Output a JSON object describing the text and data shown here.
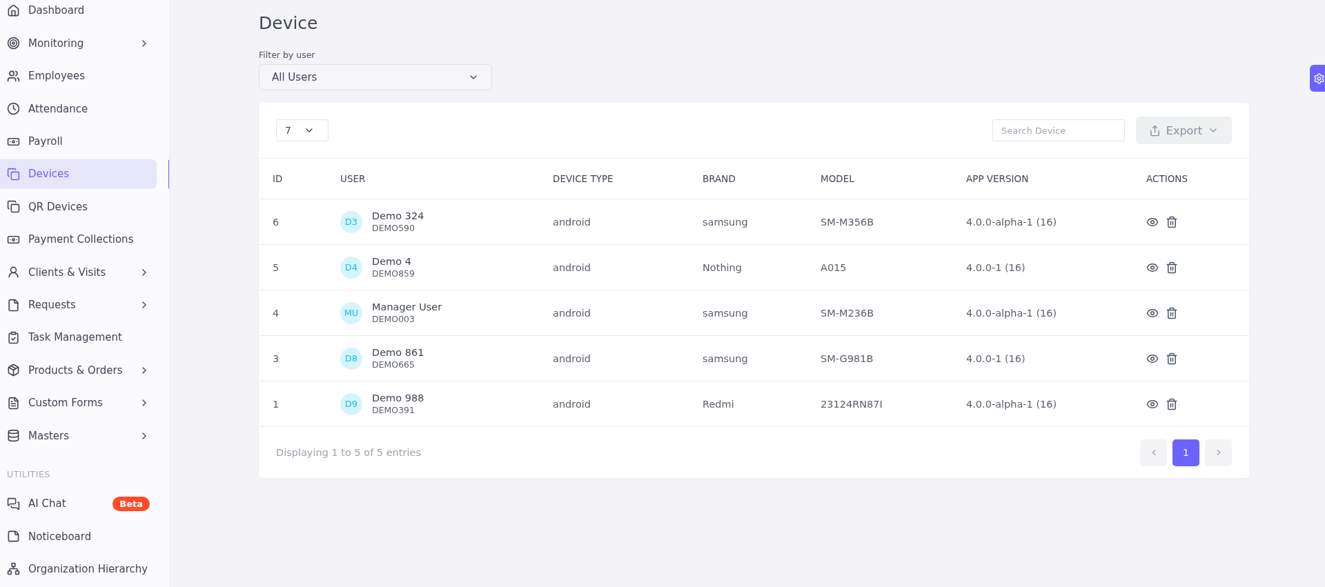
{
  "sidebar": {
    "items": [
      {
        "label": "Dashboard",
        "selected": false,
        "expandable": false
      },
      {
        "label": "Monitoring",
        "selected": false,
        "expandable": true
      },
      {
        "label": "Employees",
        "selected": false,
        "expandable": false
      },
      {
        "label": "Attendance",
        "selected": false,
        "expandable": false
      },
      {
        "label": "Payroll",
        "selected": false,
        "expandable": false
      },
      {
        "label": "Devices",
        "selected": true,
        "expandable": false
      },
      {
        "label": "QR Devices",
        "selected": false,
        "expandable": false
      },
      {
        "label": "Payment Collections",
        "selected": false,
        "expandable": false
      },
      {
        "label": "Clients & Visits",
        "selected": false,
        "expandable": true
      },
      {
        "label": "Requests",
        "selected": false,
        "expandable": true
      },
      {
        "label": "Task Management",
        "selected": false,
        "expandable": false
      },
      {
        "label": "Products & Orders",
        "selected": false,
        "expandable": true
      },
      {
        "label": "Custom Forms",
        "selected": false,
        "expandable": true
      },
      {
        "label": "Masters",
        "selected": false,
        "expandable": true
      }
    ],
    "section": {
      "heading": "UTILITIES",
      "items": [
        {
          "label": "AI Chat",
          "selected": false,
          "expandable": false,
          "badge": "Beta"
        },
        {
          "label": "Noticeboard",
          "selected": false,
          "expandable": false
        },
        {
          "label": "Organization Hierarchy",
          "selected": false,
          "expandable": false
        }
      ]
    }
  },
  "page": {
    "title": "Device",
    "filter": {
      "label": "Filter by user",
      "value": "All Users"
    }
  },
  "table": {
    "page_size": "7",
    "search": {
      "placeholder": "Search Device"
    },
    "export_button": "Export",
    "columns": [
      "ID",
      "USER",
      "DEVICE TYPE",
      "BRAND",
      "MODEL",
      "APP VERSION",
      "ACTIONS"
    ],
    "rows": [
      {
        "id": "6",
        "initials": "D3",
        "name": "Demo 324",
        "code": "DEMO590",
        "device_type": "android",
        "brand": "samsung",
        "model": "SM-M356B",
        "app_version": "4.0.0-alpha-1 (16)"
      },
      {
        "id": "5",
        "initials": "D4",
        "name": "Demo 4",
        "code": "DEMO859",
        "device_type": "android",
        "brand": "Nothing",
        "model": "A015",
        "app_version": "4.0.0-1 (16)"
      },
      {
        "id": "4",
        "initials": "MU",
        "name": "Manager User",
        "code": "DEMO003",
        "device_type": "android",
        "brand": "samsung",
        "model": "SM-M236B",
        "app_version": "4.0.0-alpha-1 (16)"
      },
      {
        "id": "3",
        "initials": "D8",
        "name": "Demo 861",
        "code": "DEMO665",
        "device_type": "android",
        "brand": "samsung",
        "model": "SM-G981B",
        "app_version": "4.0.0-1 (16)"
      },
      {
        "id": "1",
        "initials": "D9",
        "name": "Demo 988",
        "code": "DEMO391",
        "device_type": "android",
        "brand": "Redmi",
        "model": "23124RN87I",
        "app_version": "4.0.0-alpha-1 (16)"
      }
    ],
    "footer": "Displaying 1 to 5 of 5 entries",
    "pages": [
      {
        "label": "1",
        "selected": true
      }
    ]
  }
}
